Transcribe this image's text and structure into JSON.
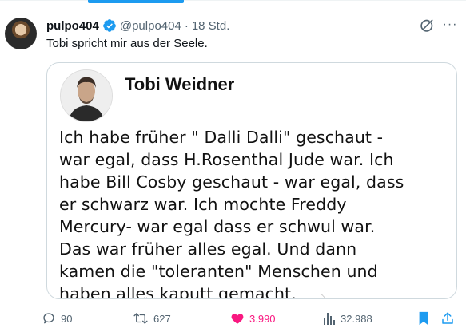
{
  "tweet": {
    "display_name": "pulpo404",
    "handle": "@pulpo404",
    "separator": "·",
    "time": "18 Std.",
    "text": "Tobi spricht mir aus der Seele."
  },
  "media": {
    "title": "Tobi Weidner",
    "lines": [
      "Ich habe früher \" Dalli Dalli\" geschaut -",
      "war egal, dass H.Rosenthal Jude war. Ich",
      "habe Bill Cosby geschaut - war egal, dass",
      "er schwarz war. Ich mochte Freddy",
      "Mercury- war egal dass er schwul war.",
      "Das war früher alles egal. Und dann",
      "kamen die \"toleranten\" Menschen und",
      "haben alles kaputt gemacht."
    ]
  },
  "actions": {
    "replies": "90",
    "reposts": "627",
    "likes": "3.990",
    "views": "32.988"
  },
  "colors": {
    "accent": "#1d9bf0",
    "like": "#f91880",
    "muted": "#536471",
    "text": "#0f1419",
    "border": "#cfd9de"
  },
  "icons": [
    "verified-badge-icon",
    "grok-icon",
    "more-icon",
    "reply-icon",
    "repost-icon",
    "like-icon",
    "views-icon",
    "bookmark-icon",
    "share-icon"
  ]
}
